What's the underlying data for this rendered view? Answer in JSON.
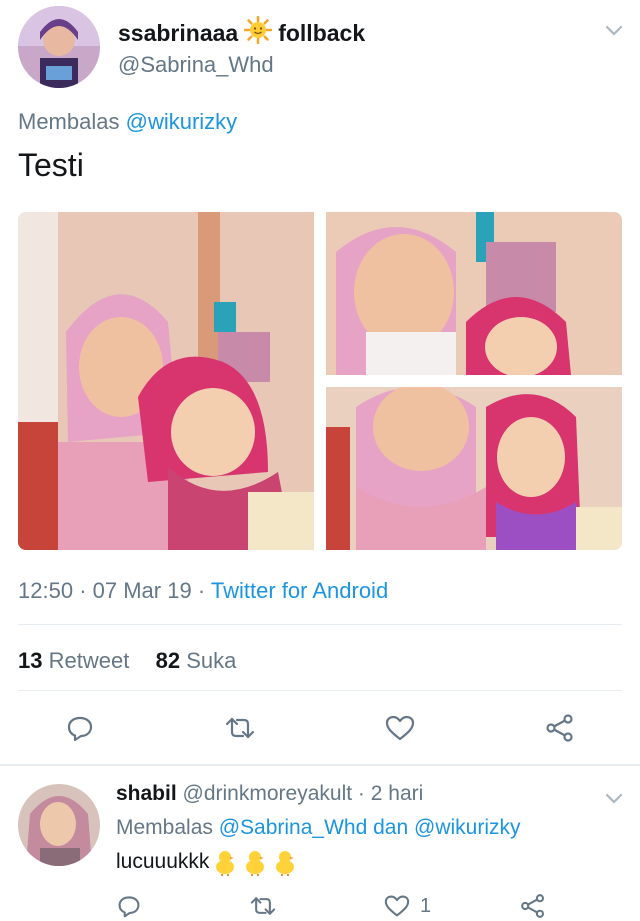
{
  "tweet": {
    "display_name_prefix": "ssabrinaaa",
    "display_name_emoji": "sun-face",
    "display_name_suffix": "follback",
    "handle": "@Sabrina_Whd",
    "reply_prefix": "Membalas",
    "reply_to": "@wikurizky",
    "text": "Testi",
    "time": "12:50",
    "date": "07 Mar 19",
    "source": "Twitter for Android",
    "retweet_count": "13",
    "retweet_label": "Retweet",
    "like_count": "82",
    "like_label": "Suka"
  },
  "reply": {
    "display_name": "shabil",
    "handle": "@drinkmoreyakult",
    "time_ago": "2 hari",
    "reply_prefix": "Membalas",
    "reply_to_1": "@Sabrina_Whd",
    "reply_and": "dan",
    "reply_to_2": "@wikurizky",
    "text": "lucuuukkk",
    "emoji": "baby-chick x3",
    "like_count": "1"
  },
  "colors": {
    "accent": "#1b95e0",
    "muted": "#657786",
    "divider": "#e6ecf0",
    "text": "#14171a"
  },
  "icons": [
    "chevron-down-icon",
    "reply-icon",
    "retweet-icon",
    "like-icon",
    "share-icon"
  ]
}
